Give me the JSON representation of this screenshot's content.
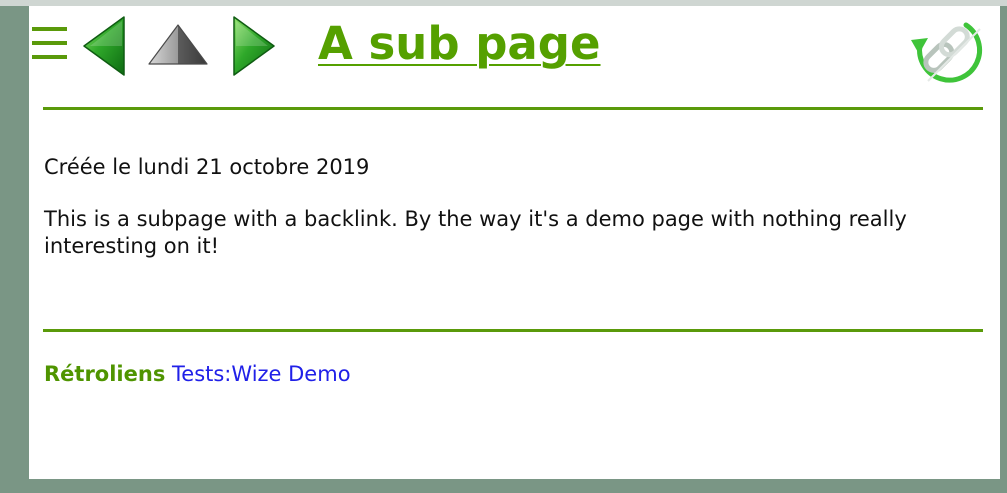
{
  "toolbar": {
    "menu_icon": "hamburger-menu-icon",
    "back_icon": "green-left-arrow-icon",
    "up_icon": "grey-up-arrow-icon",
    "forward_icon": "green-right-arrow-icon",
    "refresh_icon": "link-refresh-icon"
  },
  "page": {
    "title": "A sub page",
    "created": "Créée le lundi 21 octobre 2019",
    "body": "This is a subpage with a backlink. By the way it's a demo page with nothing really interesting on it!"
  },
  "backlinks": {
    "label": "Rétroliens",
    "links": [
      {
        "text": "Tests:Wize Demo"
      }
    ]
  },
  "colors": {
    "accent": "#55a000",
    "rule": "#5a9a0a",
    "link": "#2020e8",
    "frame": "#7a9685",
    "background": "#ffffff"
  }
}
